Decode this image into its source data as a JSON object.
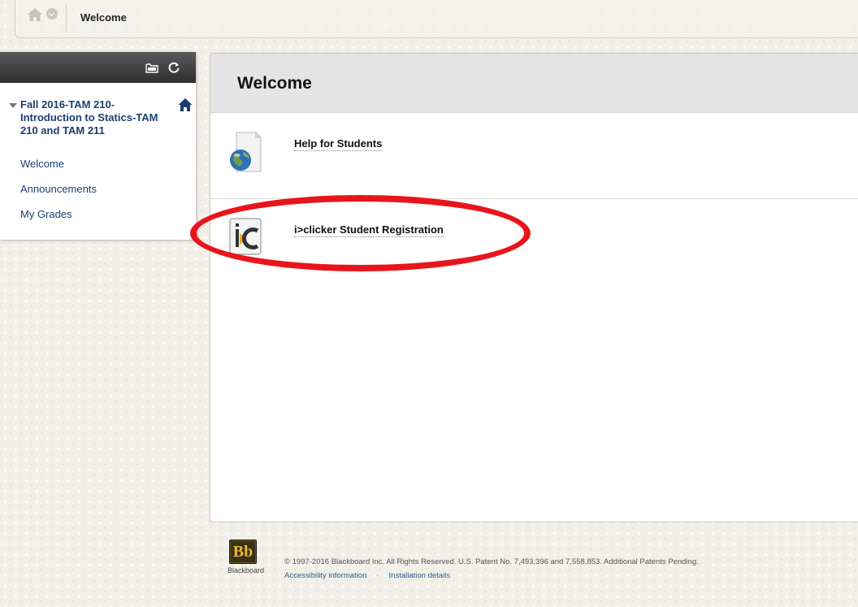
{
  "breadcrumb": {
    "title": "Welcome",
    "home_icon": "home-icon",
    "menu_icon": "chevron-down-icon"
  },
  "course_menu": {
    "header_icons": [
      "folder-icon",
      "refresh-icon"
    ],
    "course_title": "Fall 2016-TAM 210-Introduction to Statics-TAM 210 and TAM 211",
    "course_home_icon": "home-icon",
    "items": [
      {
        "label": "Welcome"
      },
      {
        "label": "Announcements"
      },
      {
        "label": "My Grades"
      }
    ]
  },
  "content": {
    "title": "Welcome",
    "items": [
      {
        "label": "Help for Students",
        "icon": "globe-document-icon"
      },
      {
        "label": "i>clicker Student Registration",
        "icon": "iclicker-icon"
      }
    ]
  },
  "footer": {
    "logo_text": "Bb",
    "logo_name": "Blackboard",
    "copyright": "© 1997-2016 Blackboard Inc. All Rights Reserved. U.S. Patent No. 7,493,396 and 7,558,853. Additional Patents Pending.",
    "links": [
      {
        "label": "Accessibility information"
      },
      {
        "label": "Installation details"
      }
    ],
    "separator": "·"
  },
  "colors": {
    "link_blue": "#1b3f6e",
    "highlight_red": "#e8151c",
    "panel_header": "#3a3a3a",
    "bb_gold": "#e9b928"
  }
}
